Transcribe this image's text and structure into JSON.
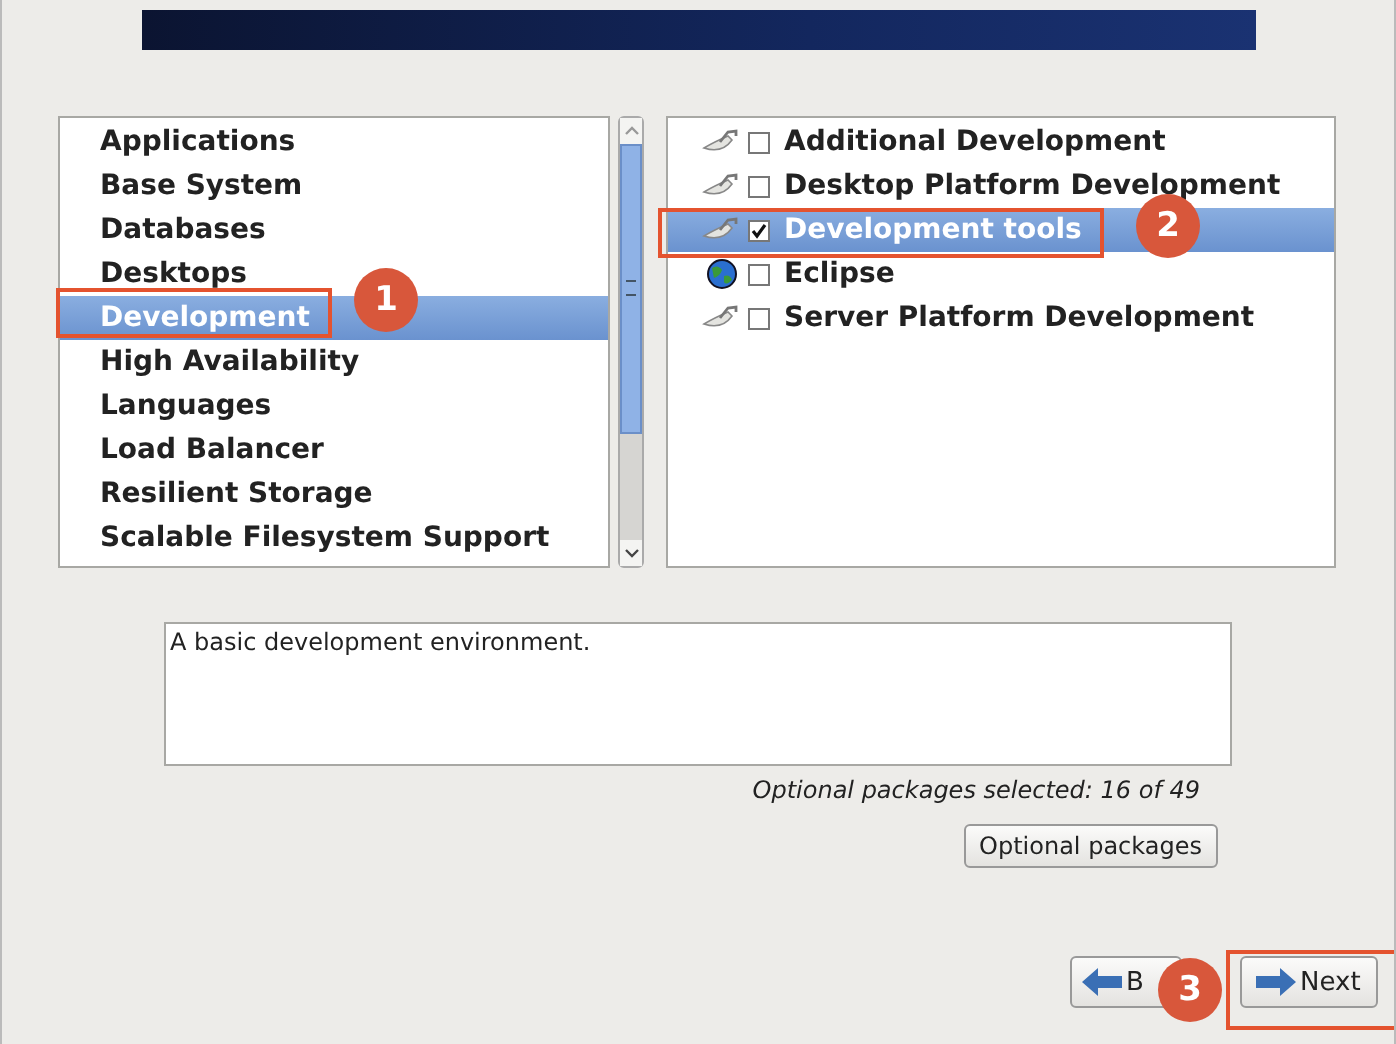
{
  "groups": [
    {
      "label": "Applications",
      "selected": false
    },
    {
      "label": "Base System",
      "selected": false
    },
    {
      "label": "Databases",
      "selected": false
    },
    {
      "label": "Desktops",
      "selected": false
    },
    {
      "label": "Development",
      "selected": true
    },
    {
      "label": "High Availability",
      "selected": false
    },
    {
      "label": "Languages",
      "selected": false
    },
    {
      "label": "Load Balancer",
      "selected": false
    },
    {
      "label": "Resilient Storage",
      "selected": false
    },
    {
      "label": "Scalable Filesystem Support",
      "selected": false
    }
  ],
  "packages": [
    {
      "label": "Additional Development",
      "kind": "dish",
      "checked": false,
      "selected": false
    },
    {
      "label": "Desktop Platform Development",
      "kind": "dish",
      "checked": false,
      "selected": false
    },
    {
      "label": "Development tools",
      "kind": "dish",
      "checked": true,
      "selected": true
    },
    {
      "label": "Eclipse",
      "kind": "globe",
      "checked": false,
      "selected": false
    },
    {
      "label": "Server Platform Development",
      "kind": "dish",
      "checked": false,
      "selected": false
    }
  ],
  "description": "A basic development environment.",
  "optional_summary": "Optional packages selected: 16 of 49",
  "optional_button": "Optional packages",
  "back_button": "B",
  "next_button": "Next",
  "callouts": [
    {
      "number": "1"
    },
    {
      "number": "2"
    },
    {
      "number": "3"
    }
  ]
}
